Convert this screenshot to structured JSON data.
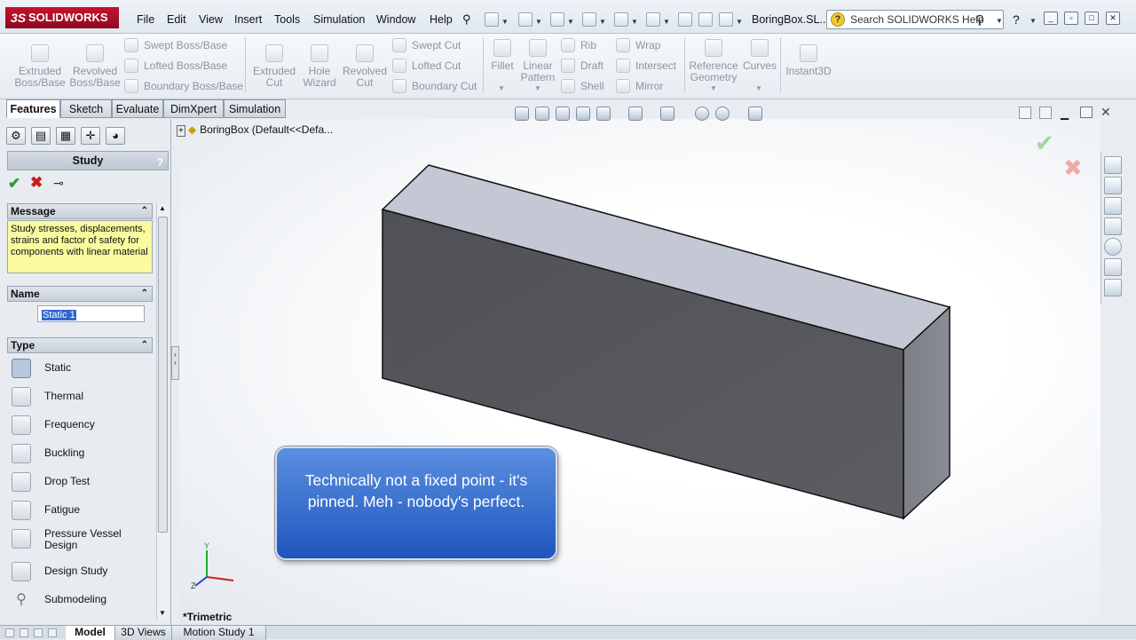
{
  "app": {
    "brand": "SOLIDWORKS",
    "brand_prefix": "3S"
  },
  "menu": [
    "File",
    "Edit",
    "View",
    "Insert",
    "Tools",
    "Simulation",
    "Window",
    "Help"
  ],
  "document_title": "BoringBox.SL...",
  "search": {
    "placeholder": "Search SOLIDWORKS Help"
  },
  "ribbon": {
    "extruded_boss": "Extruded Boss/Base",
    "revolved_boss": "Revolved Boss/Base",
    "swept_boss": "Swept Boss/Base",
    "lofted_boss": "Lofted Boss/Base",
    "boundary_boss": "Boundary Boss/Base",
    "extruded_cut": "Extruded Cut",
    "hole_wizard": "Hole Wizard",
    "revolved_cut": "Revolved Cut",
    "swept_cut": "Swept Cut",
    "lofted_cut": "Lofted Cut",
    "boundary_cut": "Boundary Cut",
    "fillet": "Fillet",
    "linear_pattern": "Linear Pattern",
    "rib": "Rib",
    "draft": "Draft",
    "shell": "Shell",
    "wrap": "Wrap",
    "intersect": "Intersect",
    "mirror": "Mirror",
    "reference_geometry": "Reference Geometry",
    "curves": "Curves",
    "instant3d": "Instant3D"
  },
  "tabs": [
    "Features",
    "Sketch",
    "Evaluate",
    "DimXpert",
    "Simulation"
  ],
  "property_manager": {
    "title": "Study",
    "help": "?",
    "message_header": "Message",
    "message": "Study stresses, displacements, strains and factor of safety for components with linear material",
    "name_header": "Name",
    "name_value": "Static 1",
    "type_header": "Type",
    "types": [
      "Static",
      "Thermal",
      "Frequency",
      "Buckling",
      "Drop Test",
      "Fatigue",
      "Pressure Vessel Design",
      "Design Study",
      "Submodeling"
    ]
  },
  "tree": {
    "root": "BoringBox  (Default<<Defa..."
  },
  "viewport": {
    "view_name": "*Trimetric",
    "triad_y": "Y",
    "triad_z": "Z"
  },
  "callout": "Technically not a fixed point - it's pinned.  Meh - nobody's perfect.",
  "bottom_tabs": [
    "Model",
    "3D Views",
    "Motion Study 1"
  ],
  "colors": {
    "accent": "#c8102e",
    "callout": "#2f67cc",
    "box_front": "#5a5b60",
    "box_top": "#c3c8d3"
  }
}
